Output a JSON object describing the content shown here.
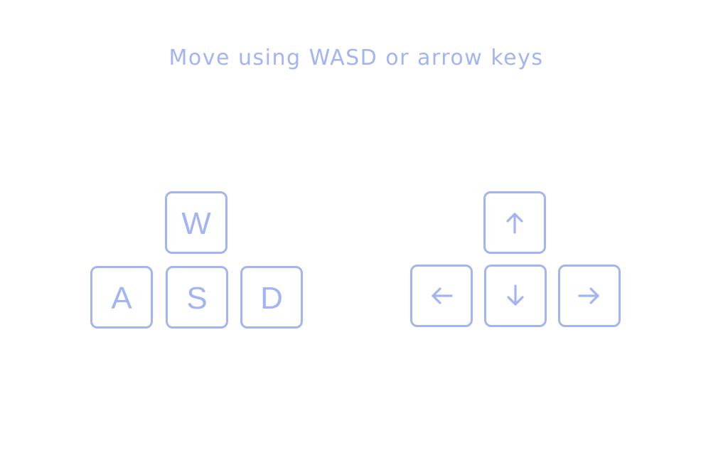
{
  "title": "Move using WASD or arrow keys",
  "accent_color": "#a3b4f5",
  "wasd": {
    "up": "W",
    "left": "A",
    "down": "S",
    "right": "D"
  },
  "arrows": {
    "up": "arrow-up-icon",
    "left": "arrow-left-icon",
    "down": "arrow-down-icon",
    "right": "arrow-right-icon"
  }
}
